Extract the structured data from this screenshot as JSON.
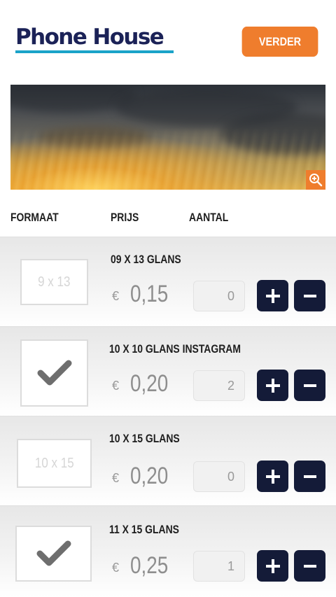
{
  "header": {
    "logo_text": "Phone House",
    "next_button": "VERDER"
  },
  "columns": {
    "format": "FORMAAT",
    "price": "PRIJS",
    "quantity": "AANTAL"
  },
  "currency_symbol": "€",
  "products": [
    {
      "title": "09 X 13 GLANS",
      "thumb_label": "9 x 13",
      "selected": false,
      "price": "0,15",
      "quantity": "0"
    },
    {
      "title": "10 X 10 GLANS INSTAGRAM",
      "thumb_label": "",
      "selected": true,
      "price": "0,20",
      "quantity": "2"
    },
    {
      "title": "10 X 15 GLANS",
      "thumb_label": "10 x 15",
      "selected": false,
      "price": "0,20",
      "quantity": "0"
    },
    {
      "title": "11 X 15 GLANS",
      "thumb_label": "",
      "selected": true,
      "price": "0,25",
      "quantity": "1"
    }
  ],
  "icons": {
    "zoom": "zoom-in-icon",
    "check": "checkmark-icon",
    "plus": "plus-icon",
    "minus": "minus-icon"
  },
  "colors": {
    "brand_navy": "#1b2257",
    "brand_cyan": "#1ba3c9",
    "accent_orange": "#ef7d2d",
    "button_dark": "#141b38"
  }
}
